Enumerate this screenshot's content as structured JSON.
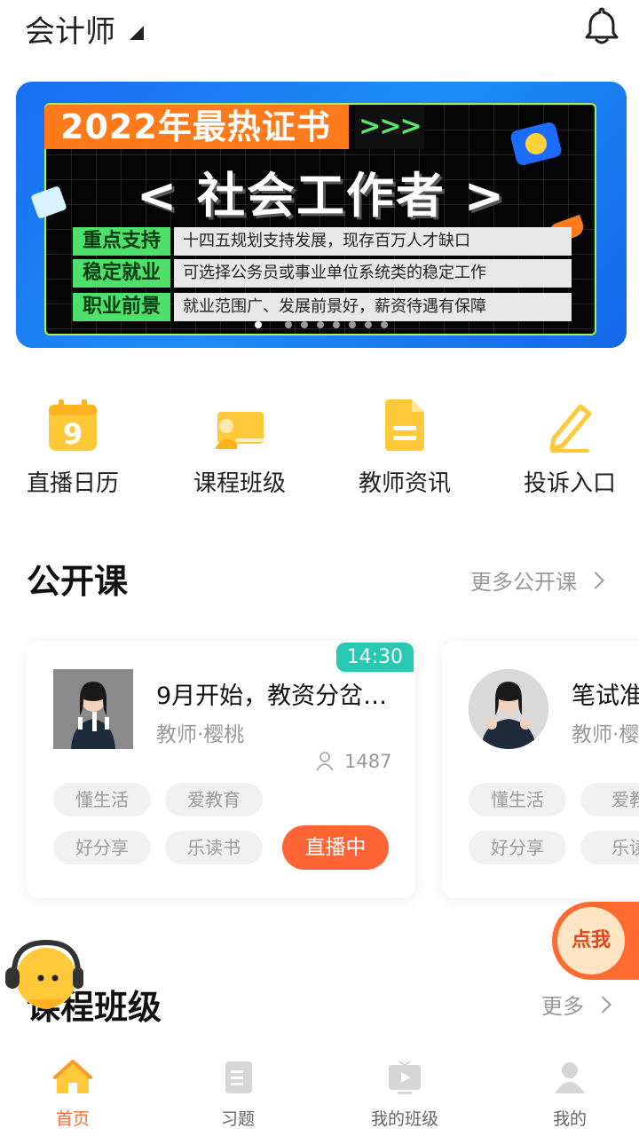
{
  "header": {
    "category": "会计师",
    "bell_icon": "bell-icon"
  },
  "banner": {
    "ribbon": "2022年最热证书",
    "arrows": ">>>",
    "headline": "< 社会工作者 >",
    "rows": [
      {
        "key": "重点支持",
        "value": "十四五规划支持发展，现存百万人才缺口"
      },
      {
        "key": "稳定就业",
        "value": "可选择公务员或事业单位系统类的稳定工作"
      },
      {
        "key": "职业前景",
        "value": "就业范围广、发展前景好，薪资待遇有保障"
      }
    ],
    "dot_count": 8,
    "active_dot": 0
  },
  "quick_menu": [
    {
      "label": "直播日历",
      "icon": "calendar-icon"
    },
    {
      "label": "课程班级",
      "icon": "classroom-icon"
    },
    {
      "label": "教师资讯",
      "icon": "document-icon"
    },
    {
      "label": "投诉入口",
      "icon": "pencil-icon"
    }
  ],
  "open_courses": {
    "title": "公开课",
    "more": "更多公开课",
    "cards": [
      {
        "time": "14:30",
        "title": "9月开始，教资分岔…",
        "teacher": "教师·樱桃",
        "viewers": "1487",
        "tags": [
          "懂生活",
          "爱教育",
          "好分享",
          "乐读书"
        ],
        "status": "直播中"
      },
      {
        "title": "笔试准",
        "teacher": "教师·樱",
        "tags": [
          "懂生活",
          "爱教",
          "好分享",
          "乐读"
        ]
      }
    ]
  },
  "course_classes": {
    "title": "课程班级",
    "more": "更多"
  },
  "float_button": {
    "label": "点我"
  },
  "tabbar": [
    {
      "label": "首页",
      "icon": "home-icon",
      "active": true
    },
    {
      "label": "习题",
      "icon": "exercise-icon",
      "active": false
    },
    {
      "label": "我的班级",
      "icon": "video-class-icon",
      "active": false
    },
    {
      "label": "我的",
      "icon": "user-icon",
      "active": false
    }
  ],
  "colors": {
    "accent": "#ff6a30",
    "teal": "#27c9b3",
    "icon_yellow": "#ffc93a"
  }
}
